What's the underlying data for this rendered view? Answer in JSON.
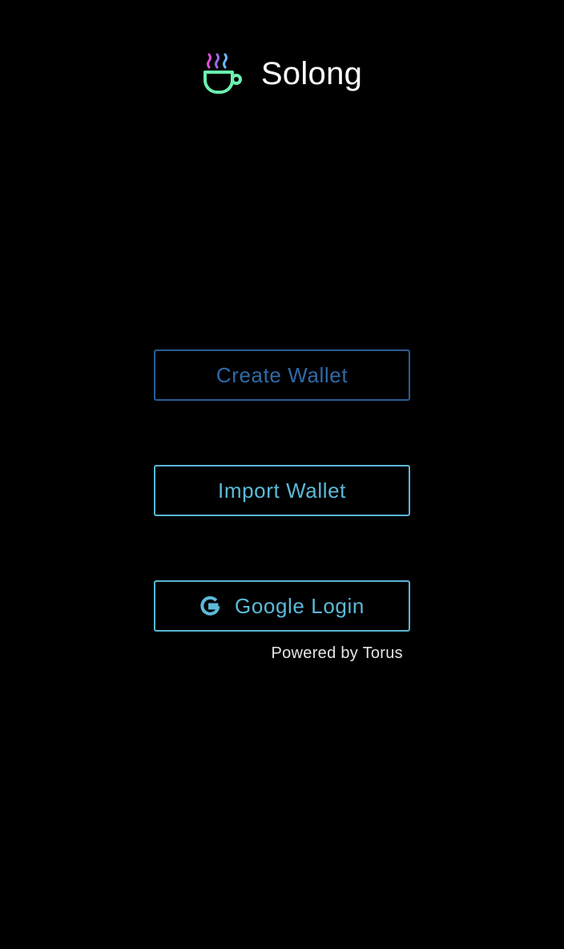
{
  "app": {
    "brand_name": "Solong",
    "logo_icon": "steaming-cup-icon"
  },
  "actions": {
    "create_wallet_label": "Create Wallet",
    "import_wallet_label": "Import Wallet",
    "google_login_label": "Google Login",
    "google_icon": "google-g-icon"
  },
  "footer": {
    "powered_by": "Powered by Torus"
  },
  "colors": {
    "background": "#000000",
    "brand_text": "#ffffff",
    "create_button": "#2f6aa8",
    "primary_accent": "#5cbad9",
    "logo_cup": "#6cf0b0",
    "logo_steam_pink": "#e04ed8",
    "logo_steam_purple": "#9a6cf0",
    "logo_steam_blue": "#6fb7ff"
  }
}
